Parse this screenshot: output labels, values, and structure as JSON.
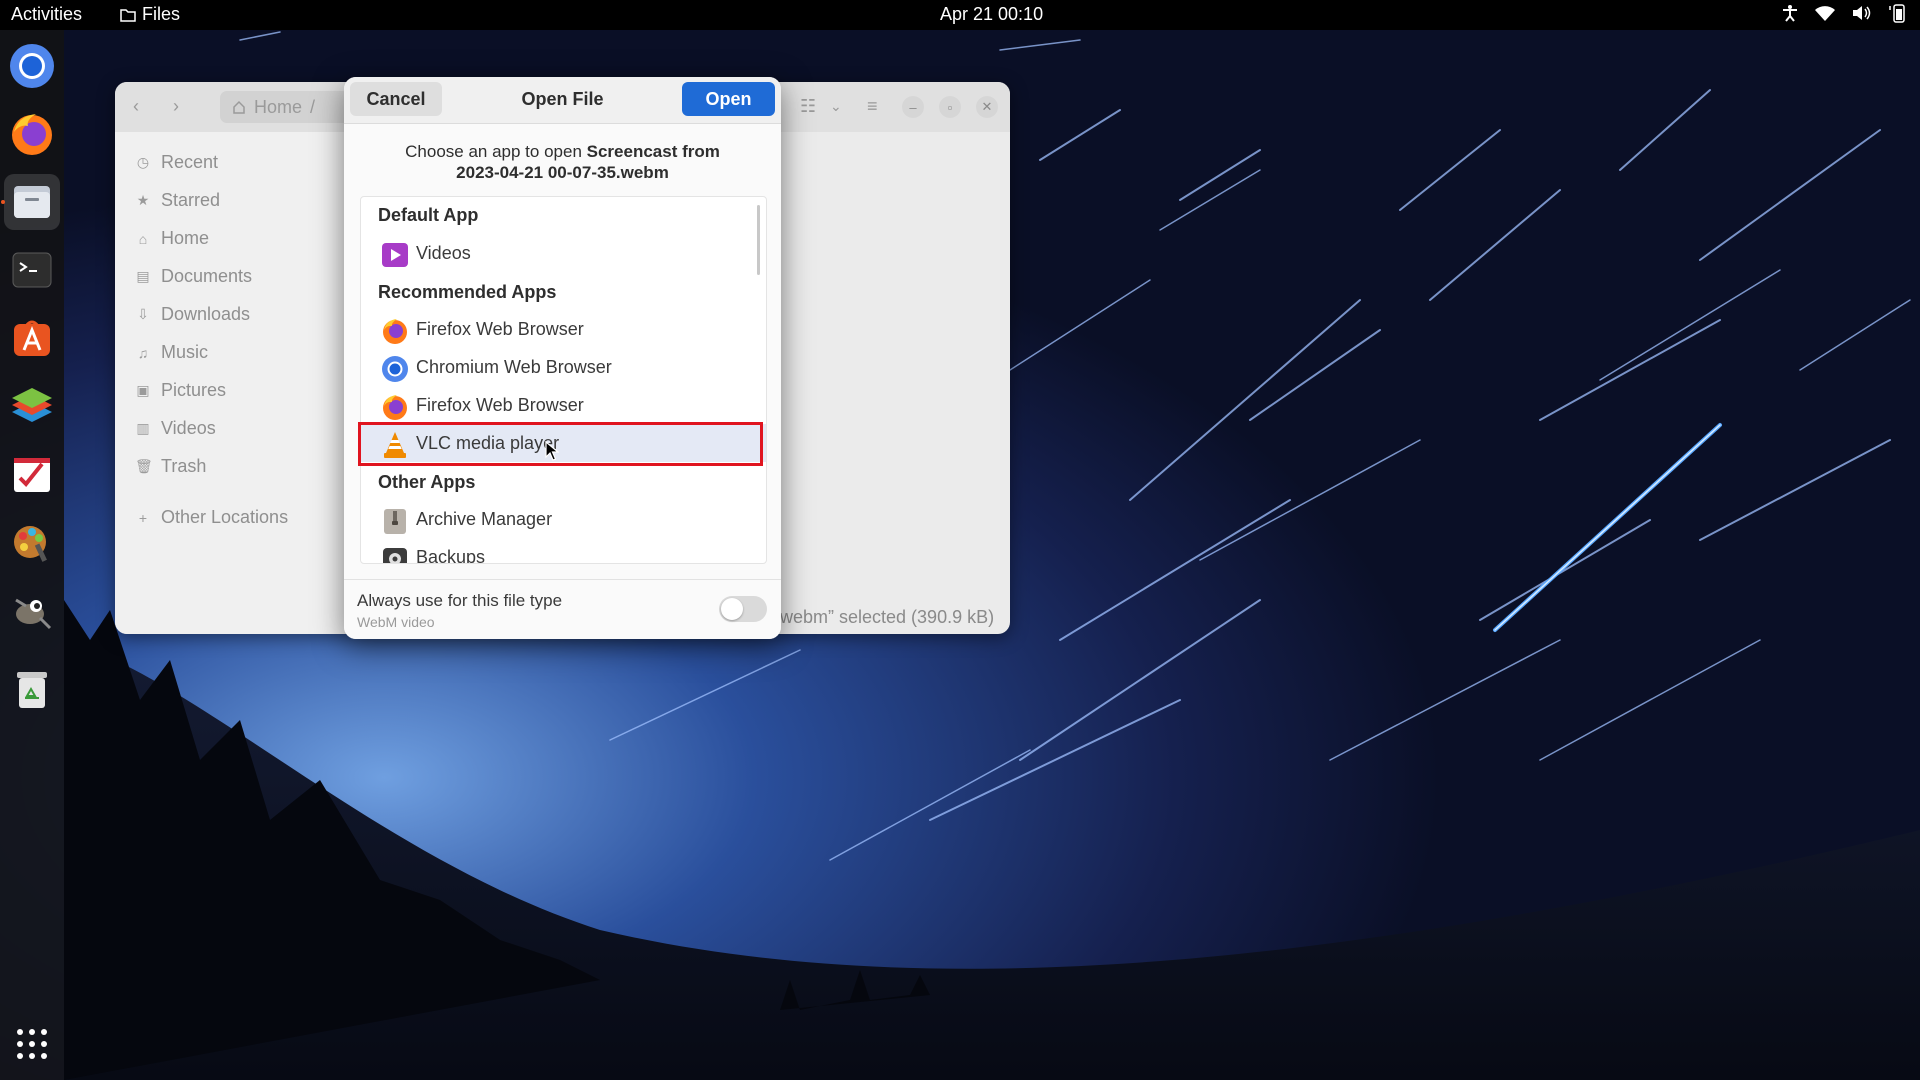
{
  "topbar": {
    "activities": "Activities",
    "app_name": "Files",
    "clock": "Apr 21  00:10"
  },
  "dock": {
    "items": [
      "chromium-icon",
      "firefox-icon",
      "files-icon",
      "terminal-icon",
      "software-center-icon",
      "layers-icon",
      "checklist-icon",
      "paint-icon",
      "gimp-icon",
      "trash-icon",
      "app-grid-icon"
    ],
    "active": "files-icon"
  },
  "files_window": {
    "path_home": "Home",
    "path_separator": "/",
    "sidebar": [
      {
        "label": "Recent",
        "icon": "clock-icon"
      },
      {
        "label": "Starred",
        "icon": "star-icon"
      },
      {
        "label": "Home",
        "icon": "home-icon"
      },
      {
        "label": "Documents",
        "icon": "document-icon"
      },
      {
        "label": "Downloads",
        "icon": "download-icon"
      },
      {
        "label": "Music",
        "icon": "music-icon"
      },
      {
        "label": "Pictures",
        "icon": "pictures-icon"
      },
      {
        "label": "Videos",
        "icon": "videos-icon"
      },
      {
        "label": "Trash",
        "icon": "trash-icon"
      },
      {
        "label": "Other Locations",
        "icon": "plus-icon"
      }
    ],
    "status": "webm” selected (390.9 kB)"
  },
  "dialog": {
    "cancel_label": "Cancel",
    "title": "Open File",
    "open_label": "Open",
    "prompt_prefix": "Choose an app to open ",
    "prompt_file_line1": "Screencast from",
    "prompt_file_line2": "2023-04-21 00-07-35.webm",
    "sections": {
      "default": "Default App",
      "recommended": "Recommended Apps",
      "other": "Other Apps"
    },
    "apps": {
      "videos": "Videos",
      "firefox1": "Firefox Web Browser",
      "chromium": "Chromium Web Browser",
      "firefox2": "Firefox Web Browser",
      "vlc": "VLC media player",
      "archive": "Archive Manager",
      "backups": "Backups"
    },
    "selected_app": "vlc",
    "always_label": "Always use for this file type",
    "always_sub": "WebM video",
    "always_enabled": false
  },
  "colors": {
    "accent": "#1f6bd6",
    "highlight_outline": "#e0141f",
    "ubuntu_orange": "#e95420"
  }
}
